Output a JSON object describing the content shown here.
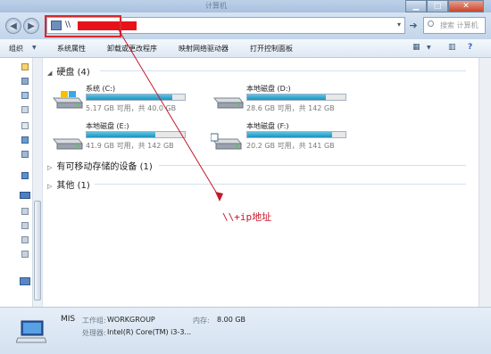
{
  "window": {
    "title": "计算机"
  },
  "address_bar": {
    "path_prefix": "\\\\",
    "dropdown_glyph": "▾"
  },
  "search": {
    "placeholder": "搜索 计算机"
  },
  "toolbar": {
    "organize": "组织",
    "system_properties": "系统属性",
    "uninstall": "卸载或更改程序",
    "map_drive": "映射网络驱动器",
    "control_panel": "打开控制面板"
  },
  "sections": {
    "hard_disks": "硬盘 (4)",
    "removable": "有可移动存储的设备 (1)",
    "other": "其他 (1)"
  },
  "drives": [
    {
      "name": "系统 (C:)",
      "info": "5.17 GB 可用，共 40.0 GB",
      "fill_fraction": 0.87
    },
    {
      "name": "本地磁盘 (D:)",
      "info": "28.6 GB 可用，共 142 GB",
      "fill_fraction": 0.8
    },
    {
      "name": "本地磁盘 (E:)",
      "info": "41.9 GB 可用，共 142 GB",
      "fill_fraction": 0.7
    },
    {
      "name": "本地磁盘 (F:)",
      "info": "20.2 GB 可用，共 141 GB",
      "fill_fraction": 0.86
    }
  ],
  "details": {
    "computer_name": "MIS",
    "workgroup_label": "工作组:",
    "workgroup": "WORKGROUP",
    "memory_label": "内存:",
    "memory": "8.00 GB",
    "processor_label": "处理器:",
    "processor": "Intel(R) Core(TM) i3-3..."
  },
  "annotation": {
    "text": "\\\\+ip地址"
  },
  "colors": {
    "annotation_red": "#c4182a",
    "drive_bar": "#1b93c0"
  }
}
